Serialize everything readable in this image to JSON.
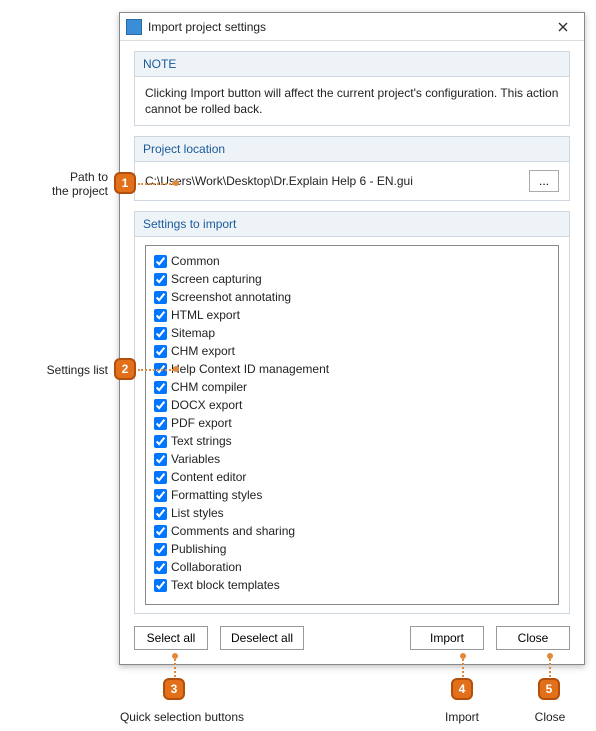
{
  "window": {
    "title": "Import project settings"
  },
  "note": {
    "header": "NOTE",
    "body": "Clicking Import button will affect the current project's configuration. This action cannot be rolled back."
  },
  "location": {
    "header": "Project location",
    "path": "C:\\Users\\Work\\Desktop\\Dr.Explain Help 6 - EN.gui",
    "browse_label": "..."
  },
  "settings": {
    "header": "Settings to import",
    "items": [
      {
        "label": "Common",
        "checked": true
      },
      {
        "label": "Screen capturing",
        "checked": true
      },
      {
        "label": "Screenshot annotating",
        "checked": true
      },
      {
        "label": "HTML export",
        "checked": true
      },
      {
        "label": "Sitemap",
        "checked": true
      },
      {
        "label": "CHM export",
        "checked": true
      },
      {
        "label": "Help Context ID management",
        "checked": true
      },
      {
        "label": "CHM compiler",
        "checked": true
      },
      {
        "label": "DOCX export",
        "checked": true
      },
      {
        "label": "PDF export",
        "checked": true
      },
      {
        "label": "Text strings",
        "checked": true
      },
      {
        "label": "Variables",
        "checked": true
      },
      {
        "label": "Content editor",
        "checked": true
      },
      {
        "label": "Formatting styles",
        "checked": true
      },
      {
        "label": "List styles",
        "checked": true
      },
      {
        "label": "Comments and sharing",
        "checked": true
      },
      {
        "label": "Publishing",
        "checked": true
      },
      {
        "label": "Collaboration",
        "checked": true
      },
      {
        "label": "Text block templates",
        "checked": true
      }
    ]
  },
  "buttons": {
    "select_all": "Select all",
    "deselect_all": "Deselect all",
    "import": "Import",
    "close": "Close"
  },
  "callouts": {
    "c1": {
      "num": "1",
      "label": "Path to\nthe project"
    },
    "c2": {
      "num": "2",
      "label": "Settings list"
    },
    "c3": {
      "num": "3",
      "label": "Quick selection buttons"
    },
    "c4": {
      "num": "4",
      "label": "Import"
    },
    "c5": {
      "num": "5",
      "label": "Close"
    }
  }
}
